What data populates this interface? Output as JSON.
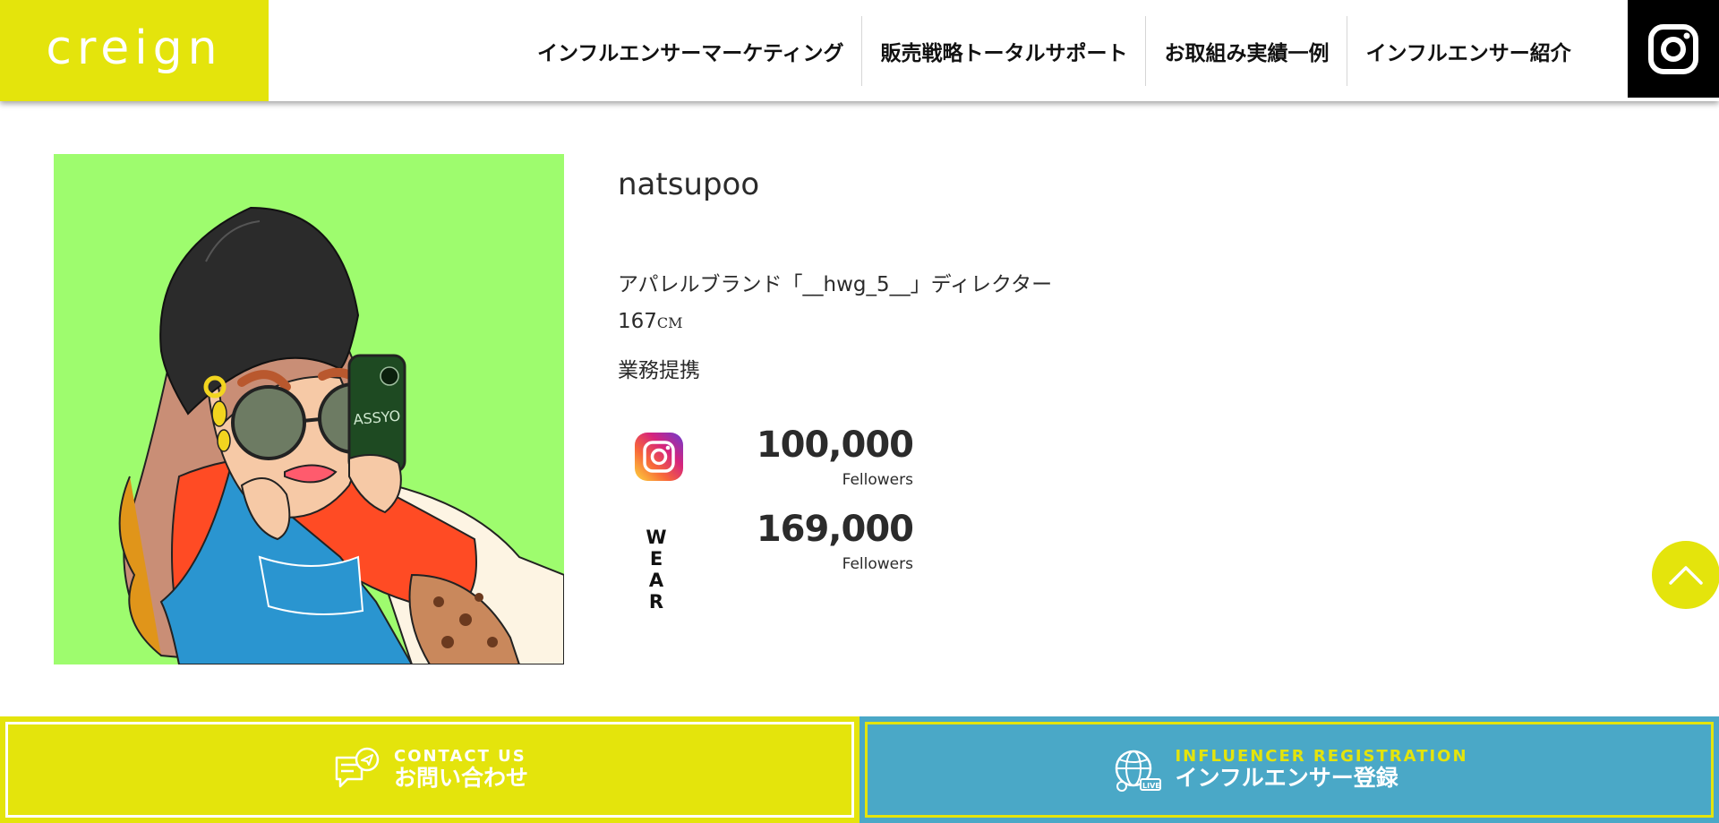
{
  "header": {
    "logo": "creign",
    "nav": [
      {
        "label": "インフルエンサーマーケティング"
      },
      {
        "label": "販売戦略トータルサポート"
      },
      {
        "label": "お取組み実績一例"
      },
      {
        "label": "インフルエンサー紹介"
      }
    ],
    "instagram_icon": "instagram-icon"
  },
  "profile": {
    "name": "natsupoo",
    "title": "アパレルブランド「__hwg_5__」ディレクター",
    "height": "167",
    "height_unit": "CM",
    "tag": "業務提携",
    "sns": [
      {
        "icon": "instagram-icon",
        "count": "100,000",
        "label": "Fellowers"
      },
      {
        "icon": "wear-logo",
        "logo_text": "W E A R",
        "count": "169,000",
        "label": "Fellowers"
      }
    ]
  },
  "cta": {
    "contact": {
      "en": "CONTACT US",
      "jp": "お問い合わせ",
      "icon": "chat-send-icon"
    },
    "registration": {
      "en": "INFLUENCER REGISTRATION",
      "jp": "インフルエンサー登録",
      "icon": "globe-live-icon"
    }
  },
  "colors": {
    "brand_yellow": "#e4e40c",
    "registration_blue": "#4aa8c7",
    "portrait_bg": "#9efc6e"
  }
}
